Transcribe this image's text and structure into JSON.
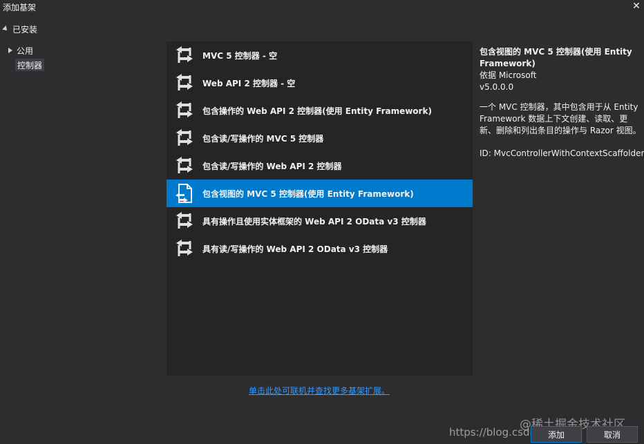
{
  "window": {
    "title": "添加基架"
  },
  "tree": {
    "installed": "已安装",
    "public": "公用",
    "controller": "控制器"
  },
  "list": {
    "items": [
      {
        "label": "MVC 5 控制器 - 空",
        "icon": "controller-icon"
      },
      {
        "label": "Web API 2 控制器 - 空",
        "icon": "controller-icon"
      },
      {
        "label": "包含操作的 Web API 2 控制器(使用 Entity Framework)",
        "icon": "controller-icon"
      },
      {
        "label": "包含读/写操作的 MVC 5 控制器",
        "icon": "controller-icon"
      },
      {
        "label": "包含读/写操作的 Web API 2 控制器",
        "icon": "controller-icon"
      },
      {
        "label": "包含视图的 MVC 5 控制器(使用 Entity Framework)",
        "icon": "controller-with-view-icon",
        "selected": true
      },
      {
        "label": "具有操作且使用实体框架的 Web API 2 OData v3 控制器",
        "icon": "controller-icon"
      },
      {
        "label": "具有读/写操作的 Web API 2 OData v3 控制器",
        "icon": "controller-icon"
      }
    ]
  },
  "detail": {
    "title": "包含视图的 MVC 5 控制器(使用 Entity Framework)",
    "author": "依据 Microsoft",
    "version": "v5.0.0.0",
    "description": "一个 MVC 控制器，其中包含用于从 Entity Framework 数据上下文创建、读取、更新、删除和列出条目的操作与 Razor 视图。",
    "id": "ID: MvcControllerWithContextScaffolder"
  },
  "footer": {
    "online_link": "单击此处可联机并查找更多基架扩展。",
    "add_button": "添加",
    "cancel_button": "取消"
  },
  "watermark": {
    "line1": "@稀土掘金技术社区",
    "line2": "https://blog.csdn.net/..."
  },
  "colors": {
    "accent": "#007acc",
    "link": "#3399ff",
    "background": "#2d2d30",
    "panel": "#252526"
  }
}
